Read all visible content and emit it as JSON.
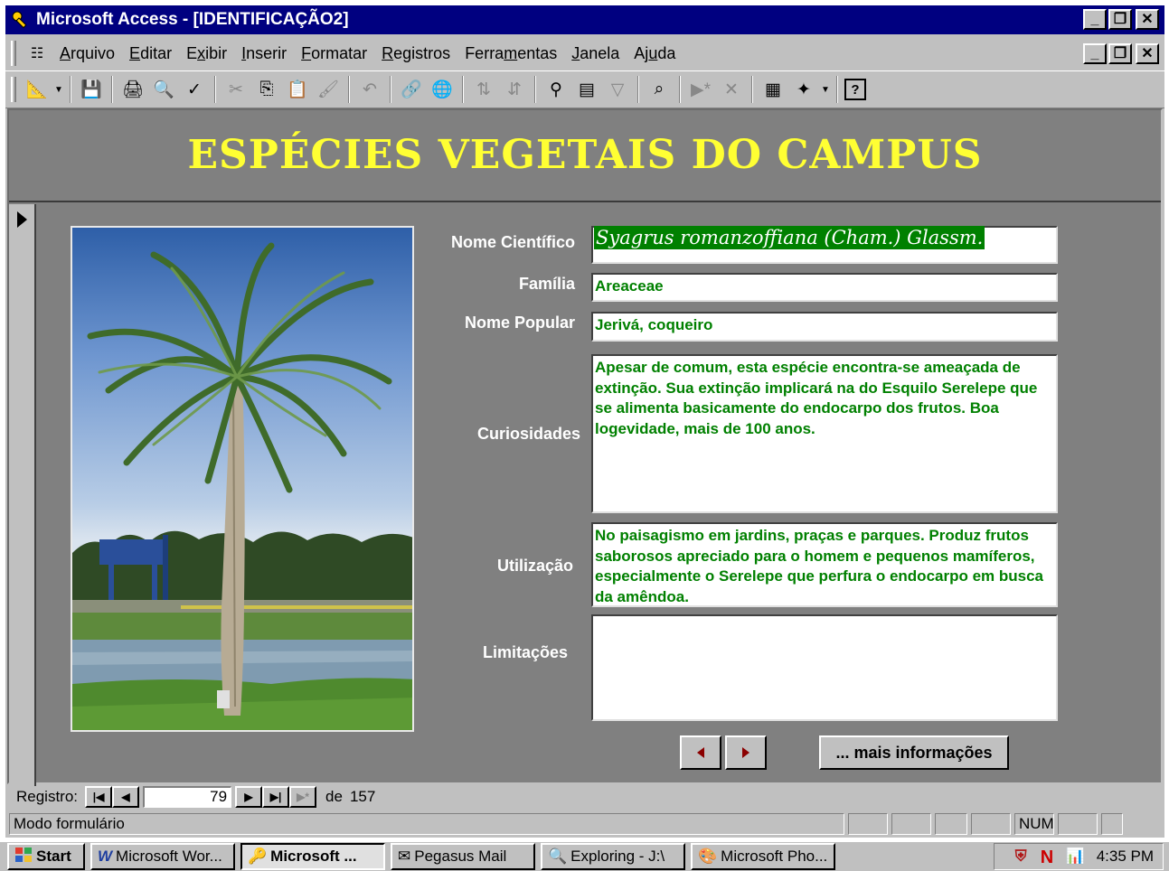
{
  "window": {
    "title": "Microsoft Access - [IDENTIFICAÇÃO2]"
  },
  "menu": {
    "items": [
      {
        "pre": "",
        "key": "A",
        "post": "rquivo"
      },
      {
        "pre": "",
        "key": "E",
        "post": "ditar"
      },
      {
        "pre": "E",
        "key": "x",
        "post": "ibir"
      },
      {
        "pre": "",
        "key": "I",
        "post": "nserir"
      },
      {
        "pre": "",
        "key": "F",
        "post": "ormatar"
      },
      {
        "pre": "",
        "key": "R",
        "post": "egistros"
      },
      {
        "pre": "Ferra",
        "key": "m",
        "post": "entas"
      },
      {
        "pre": "",
        "key": "J",
        "post": "anela"
      },
      {
        "pre": "Aj",
        "key": "u",
        "post": "da"
      }
    ]
  },
  "toolbar": {
    "icons": [
      "design-view-icon",
      "save-icon",
      "print-icon",
      "print-preview-icon",
      "spelling-icon",
      "cut-icon",
      "copy-icon",
      "paste-icon",
      "format-painter-icon",
      "undo-icon",
      "insert-hyperlink-icon",
      "web-toolbar-icon",
      "sort-ascending-icon",
      "sort-descending-icon",
      "filter-by-selection-icon",
      "filter-by-form-icon",
      "apply-filter-icon",
      "find-icon",
      "new-record-icon",
      "delete-record-icon",
      "properties-icon",
      "new-object-icon",
      "help-icon"
    ]
  },
  "form": {
    "title": "ESPÉCIES VEGETAIS DO CAMPUS",
    "fields": {
      "nome_cientifico": {
        "label": "Nome Científico",
        "value": "Syagrus romanzoffiana (Cham.) Glassm."
      },
      "familia": {
        "label": "Família",
        "value": "Areaceae"
      },
      "nome_popular": {
        "label": "Nome Popular",
        "value": "Jerivá, coqueiro"
      },
      "curiosidades": {
        "label": "Curiosidades",
        "value": "Apesar de comum, esta espécie encontra-se ameaçada de extinção. Sua extinção implicará na do Esquilo Serelepe que se alimenta basicamente do endocarpo dos frutos. Boa logevidade, mais de 100 anos."
      },
      "utilizacao": {
        "label": "Utilização",
        "value": "No paisagismo em jardins, praças e parques. Produz frutos saborosos apreciado para o homem e pequenos mamíferos, especialmente o Serelepe que perfura o endocarpo em busca da amêndoa."
      },
      "limitacoes": {
        "label": "Limitações",
        "value": ""
      }
    },
    "more_button": "... mais informações"
  },
  "record_nav": {
    "label": "Registro:",
    "current": "79",
    "of_label": "de",
    "total": "157"
  },
  "status": {
    "mode": "Modo formulário",
    "num": "NUM"
  },
  "taskbar": {
    "start": "Start",
    "tasks": [
      "Microsoft Wor...",
      "Microsoft ...",
      "Pegasus Mail",
      "Exploring - J:\\",
      "Microsoft Pho..."
    ],
    "clock": "4:35 PM"
  },
  "colors": {
    "title_bar": "#000080",
    "form_bg": "#808080",
    "heading": "#ffff33",
    "field_text": "#008000"
  }
}
